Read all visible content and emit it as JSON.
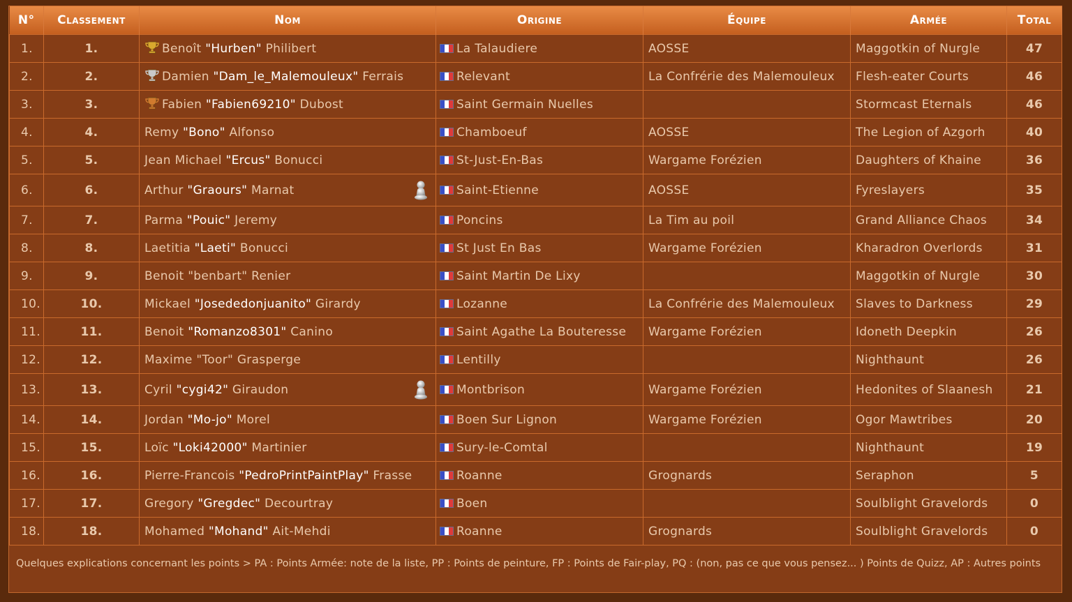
{
  "headers": {
    "num": "N°",
    "rank": "Classement",
    "name": "Nom",
    "origin": "Origine",
    "team": "Équipe",
    "army": "Armée",
    "total": "Total"
  },
  "rows": [
    {
      "num": "1.",
      "rank": "1.",
      "first": "Benoît",
      "nick": "\"Hurben\"",
      "last": "Philibert",
      "trophy": "gold",
      "figure": false,
      "origin": "La Talaudiere",
      "team": "AOSSE",
      "army": "Maggotkin of Nurgle",
      "total": "47"
    },
    {
      "num": "2.",
      "rank": "2.",
      "first": "Damien",
      "nick": "\"Dam_le_Malemouleux\"",
      "last": "Ferrais",
      "trophy": "silver",
      "figure": false,
      "origin": "Relevant",
      "team": "La Confrérie des Malemouleux",
      "army": "Flesh-eater Courts",
      "total": "46"
    },
    {
      "num": "3.",
      "rank": "3.",
      "first": "Fabien",
      "nick": "\"Fabien69210\"",
      "last": "Dubost",
      "trophy": "bronze",
      "figure": false,
      "origin": "Saint Germain Nuelles",
      "team": "",
      "army": "Stormcast Eternals",
      "total": "46"
    },
    {
      "num": "4.",
      "rank": "4.",
      "first": "Remy",
      "nick": "\"Bono\"",
      "last": "Alfonso",
      "trophy": "",
      "figure": false,
      "origin": "Chamboeuf",
      "team": "AOSSE",
      "army": "The Legion of Azgorh",
      "total": "40"
    },
    {
      "num": "5.",
      "rank": "5.",
      "first": "Jean Michael",
      "nick": "\"Ercus\"",
      "last": "Bonucci",
      "trophy": "",
      "figure": false,
      "origin": "St-Just-En-Bas",
      "team": "Wargame Forézien",
      "army": "Daughters of Khaine",
      "total": "36"
    },
    {
      "num": "6.",
      "rank": "6.",
      "first": "Arthur",
      "nick": "\"Graours\"",
      "last": "Marnat",
      "trophy": "",
      "figure": true,
      "origin": "Saint-Etienne",
      "team": "AOSSE",
      "army": "Fyreslayers",
      "total": "35"
    },
    {
      "num": "7.",
      "rank": "7.",
      "first": "Parma",
      "nick": "\"Pouic\"",
      "last": "Jeremy",
      "trophy": "",
      "figure": false,
      "origin": "Poncins",
      "team": "La Tim au poil",
      "army": "Grand Alliance Chaos",
      "total": "34"
    },
    {
      "num": "8.",
      "rank": "8.",
      "first": "Laetitia",
      "nick": "\"Laeti\"",
      "last": "Bonucci",
      "trophy": "",
      "figure": false,
      "origin": "St Just En Bas",
      "team": "Wargame Forézien",
      "army": "Kharadron Overlords",
      "total": "31"
    },
    {
      "num": "9.",
      "rank": "9.",
      "first": "Benoit \"benbart\" Renier",
      "nick": "",
      "last": "",
      "trophy": "",
      "figure": false,
      "origin": "Saint Martin De Lixy",
      "team": "",
      "army": "Maggotkin of Nurgle",
      "total": "30"
    },
    {
      "num": "10.",
      "rank": "10.",
      "first": "Mickael",
      "nick": "\"Josededonjuanito\"",
      "last": "Girardy",
      "trophy": "",
      "figure": false,
      "origin": "Lozanne",
      "team": "La Confrérie des Malemouleux",
      "army": "Slaves to Darkness",
      "total": "29"
    },
    {
      "num": "11.",
      "rank": "11.",
      "first": "Benoit",
      "nick": "\"Romanzo8301\"",
      "last": "Canino",
      "trophy": "",
      "figure": false,
      "origin": "Saint Agathe La Bouteresse",
      "team": "Wargame Forézien",
      "army": "Idoneth Deepkin",
      "total": "26"
    },
    {
      "num": "12.",
      "rank": "12.",
      "first": "Maxime \"Toor\" Grasperge",
      "nick": "",
      "last": "",
      "trophy": "",
      "figure": false,
      "origin": "Lentilly",
      "team": "",
      "army": "Nighthaunt",
      "total": "26"
    },
    {
      "num": "13.",
      "rank": "13.",
      "first": "Cyril",
      "nick": "\"cygi42\"",
      "last": "Giraudon",
      "trophy": "",
      "figure": true,
      "origin": "Montbrison",
      "team": "Wargame Forézien",
      "army": "Hedonites of Slaanesh",
      "total": "21"
    },
    {
      "num": "14.",
      "rank": "14.",
      "first": "Jordan",
      "nick": "\"Mo-jo\"",
      "last": "Morel",
      "trophy": "",
      "figure": false,
      "origin": "Boen Sur Lignon",
      "team": "Wargame Forézien",
      "army": "Ogor Mawtribes",
      "total": "20"
    },
    {
      "num": "15.",
      "rank": "15.",
      "first": "Loïc",
      "nick": "\"Loki42000\"",
      "last": "Martinier",
      "trophy": "",
      "figure": false,
      "origin": "Sury-le-Comtal",
      "team": "",
      "army": "Nighthaunt",
      "total": "19"
    },
    {
      "num": "16.",
      "rank": "16.",
      "first": "Pierre-Francois",
      "nick": "\"PedroPrintPaintPlay\"",
      "last": "Frasse",
      "trophy": "",
      "figure": false,
      "origin": "Roanne",
      "team": "Grognards",
      "army": "Seraphon",
      "total": "5"
    },
    {
      "num": "17.",
      "rank": "17.",
      "first": "Gregory",
      "nick": "\"Gregdec\"",
      "last": "Decourtray",
      "trophy": "",
      "figure": false,
      "origin": "Boen",
      "team": "",
      "army": "Soulblight Gravelords",
      "total": "0"
    },
    {
      "num": "18.",
      "rank": "18.",
      "first": "Mohamed",
      "nick": "\"Mohand\"",
      "last": "Ait-Mehdi",
      "trophy": "",
      "figure": false,
      "origin": "Roanne",
      "team": "Grognards",
      "army": "Soulblight Gravelords",
      "total": "0"
    }
  ],
  "footer": "Quelques explications concernant les points > PA : Points Armée: note de la liste, PP : Points de peinture, FP : Points de Fair-play, PQ : (non, pas ce que vous pensez... ) Points de Quizz, AP : Autres points",
  "colors": {
    "background": "#5a2a0c",
    "panel": "#853d16",
    "header_top": "#e98b45",
    "header_bottom": "#c45f1f",
    "grid": "#c96a2c",
    "gold": "#d9a92e",
    "silver": "#c9c9c9",
    "bronze": "#d07a2e"
  }
}
